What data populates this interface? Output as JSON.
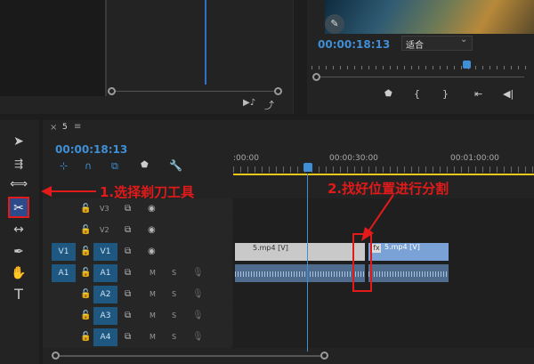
{
  "program": {
    "timecode": "00:00:18:13",
    "fit_label": "适合",
    "fit_arrow": "⌄",
    "transport_buttons": [
      "marker",
      "in-point",
      "out-point",
      "go-to-in",
      "step-back"
    ]
  },
  "sequence": {
    "close_glyph": "×",
    "name": "5",
    "menu_glyph": "≡",
    "timecode": "00:00:18:13"
  },
  "ruler": {
    "labels": [
      ":00:00",
      "00:00:30:00",
      "00:01:00:00"
    ]
  },
  "tracks": {
    "video": [
      {
        "label": "V3",
        "source": "",
        "active": false
      },
      {
        "label": "V2",
        "source": "",
        "active": false
      },
      {
        "label": "V1",
        "source": "V1",
        "active": true
      }
    ],
    "audio": [
      {
        "label": "A1",
        "source": "A1",
        "active": true
      },
      {
        "label": "A2",
        "source": "",
        "active": true
      },
      {
        "label": "A3",
        "source": "",
        "active": true
      },
      {
        "label": "A4",
        "source": "",
        "active": true
      }
    ],
    "mute": "M",
    "solo": "S"
  },
  "clips": {
    "v1_left": "5.mp4 [V]",
    "v1_right": "5.mp4 [V]",
    "fx": "fx"
  },
  "annotations": {
    "step1": "1.选择剃刀工具",
    "step2": "2.找好位置进行分割"
  },
  "colors": {
    "accent": "#3f8fd6",
    "annotation": "#e21a1a",
    "video_clip": "#c9c9c9",
    "video_clip_selected": "#7aa2d6",
    "audio_clip": "#4f6b8e",
    "work_area": "#e8c61a"
  }
}
